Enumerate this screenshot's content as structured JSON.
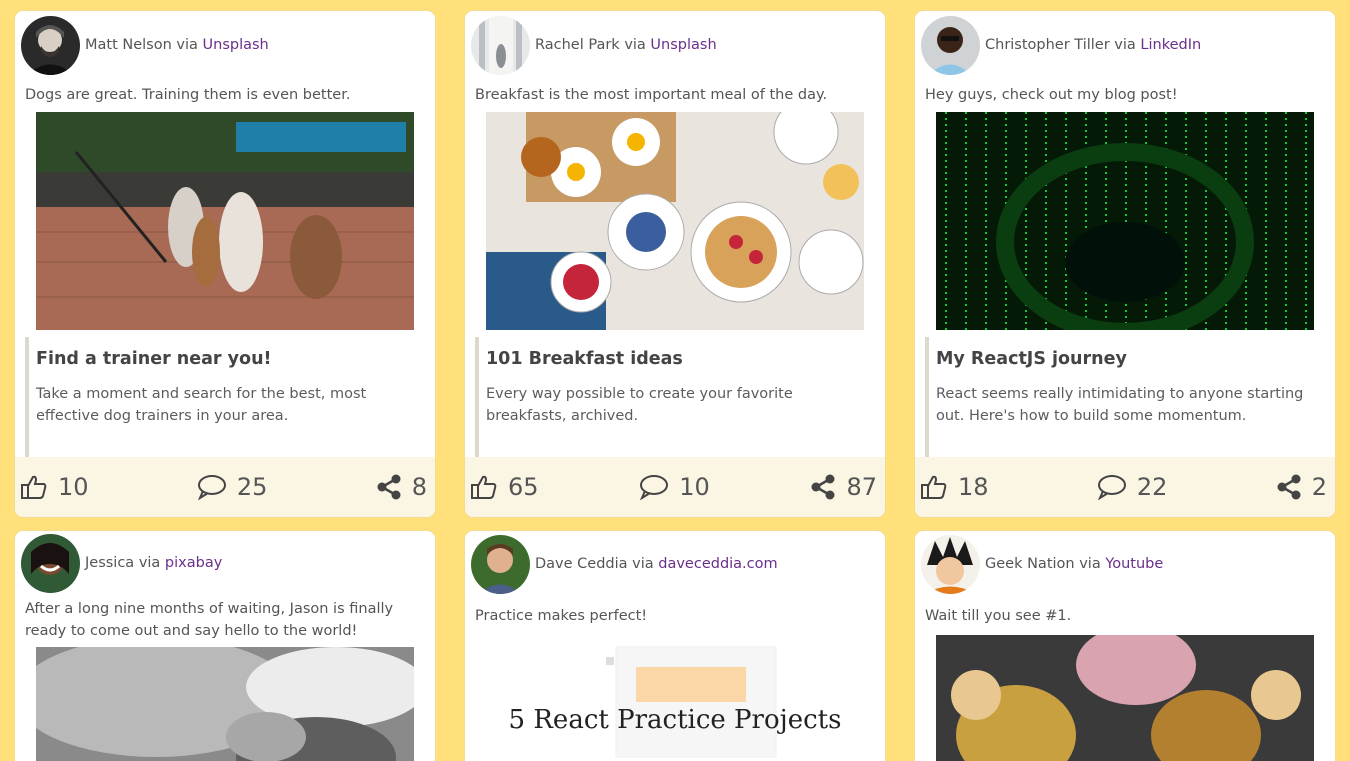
{
  "posts": [
    {
      "author": "Matt Nelson",
      "via": "via",
      "source": "Unsplash",
      "text": "Dogs are great. Training them is even better.",
      "link_title": "Find a trainer near you!",
      "link_desc": "Take a moment and search for the best, most effective dog trainers in your area.",
      "likes": "10",
      "comments": "25",
      "shares": "8"
    },
    {
      "author": "Rachel Park",
      "via": "via",
      "source": "Unsplash",
      "text": "Breakfast is the most important meal of the day.",
      "link_title": "101 Breakfast ideas",
      "link_desc": "Every way possible to create your favorite breakfasts, archived.",
      "likes": "65",
      "comments": "10",
      "shares": "87"
    },
    {
      "author": "Christopher Tiller",
      "via": "via",
      "source": "LinkedIn",
      "text": "Hey guys, check out my blog post!",
      "link_title": "My ReactJS journey",
      "link_desc": "React seems really intimidating to anyone starting out. Here's how to build some momentum.",
      "likes": "18",
      "comments": "22",
      "shares": "2"
    },
    {
      "author": "Jessica",
      "via": "via",
      "source": "pixabay",
      "text": "After a long nine months of waiting, Jason is finally ready to come out and say hello to the world!"
    },
    {
      "author": "Dave Ceddia",
      "via": "via",
      "source": "daveceddia.com",
      "text": "Practice makes perfect!",
      "image_caption": "5 React Practice Projects"
    },
    {
      "author": "Geek Nation",
      "via": "via",
      "source": "Youtube",
      "text": "Wait till you see #1."
    }
  ],
  "colors": {
    "background": "#ffe07a",
    "link": "#6a2f8a",
    "footer": "#fbf6e4"
  },
  "icons": {
    "like": "thumbs-up-icon",
    "comment": "comment-bubble-icon",
    "share": "share-icon"
  }
}
